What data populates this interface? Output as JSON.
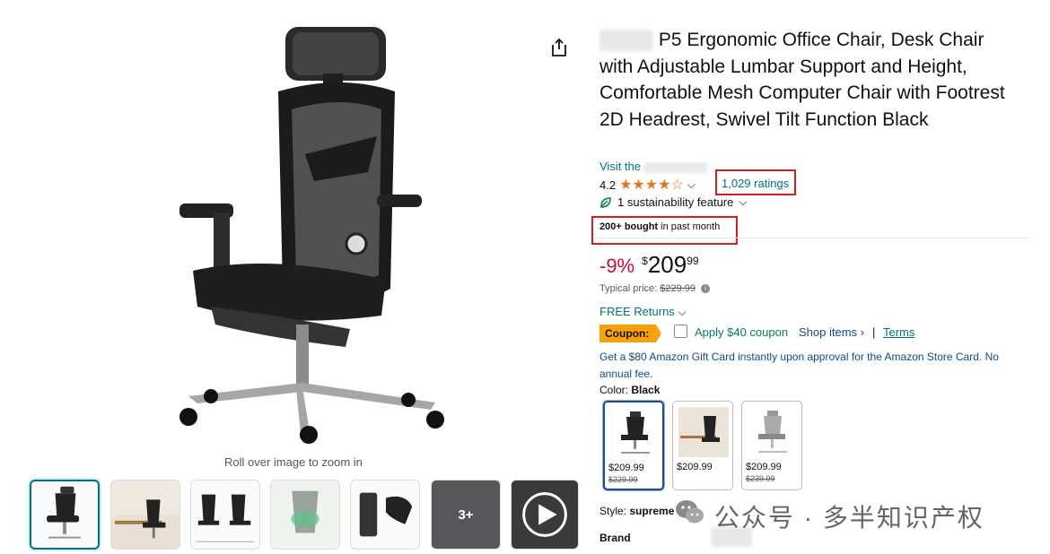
{
  "product": {
    "title_prefix_blurred": "",
    "title": "P5 Ergonomic Office Chair, Desk Chair with Adjustable Lumbar Support and Height, Comfortable Mesh Computer Chair with Footrest 2D Headrest, Swivel Tilt Function Black",
    "store_prefix": "Visit the",
    "rating_value": "4.2",
    "rating_stars": 4.2,
    "ratings_count": "1,029 ratings",
    "sustainability": "1 sustainability feature",
    "bought_bold": "200+ bought",
    "bought_rest": "in past month",
    "discount": "-9%",
    "price_symbol": "$",
    "price_whole": "209",
    "price_fraction": "99",
    "typical_label": "Typical price:",
    "typical_price": "$229.99",
    "returns": "FREE Returns",
    "coupon_badge": "Coupon:",
    "coupon_text": "Apply $40 coupon",
    "shop_items": "Shop items ›",
    "separator": "|",
    "terms": "Terms",
    "gift_card": "Get a $80 Amazon Gift Card instantly upon approval for the Amazon Store Card. No annual fee.",
    "color_label": "Color:",
    "color_value": "Black",
    "swatches": [
      {
        "price": "$209.99",
        "was": "$229.99"
      },
      {
        "price": "$209.99",
        "was": ""
      },
      {
        "price": "$209.99",
        "was": "$239.99"
      }
    ],
    "style_label": "Style:",
    "style_value": "supreme",
    "brand_label": "Brand"
  },
  "gallery": {
    "zoom_hint": "Roll over image to zoom in",
    "more_count": "3+"
  },
  "watermark": {
    "text": "公众号 · 多半知识产权"
  },
  "colors": {
    "accent_link": "#007185",
    "discount_red": "#cc0c39",
    "star_orange": "#de7921",
    "coupon_orange": "#f7a20a",
    "highlight_red": "#d91c1c"
  }
}
